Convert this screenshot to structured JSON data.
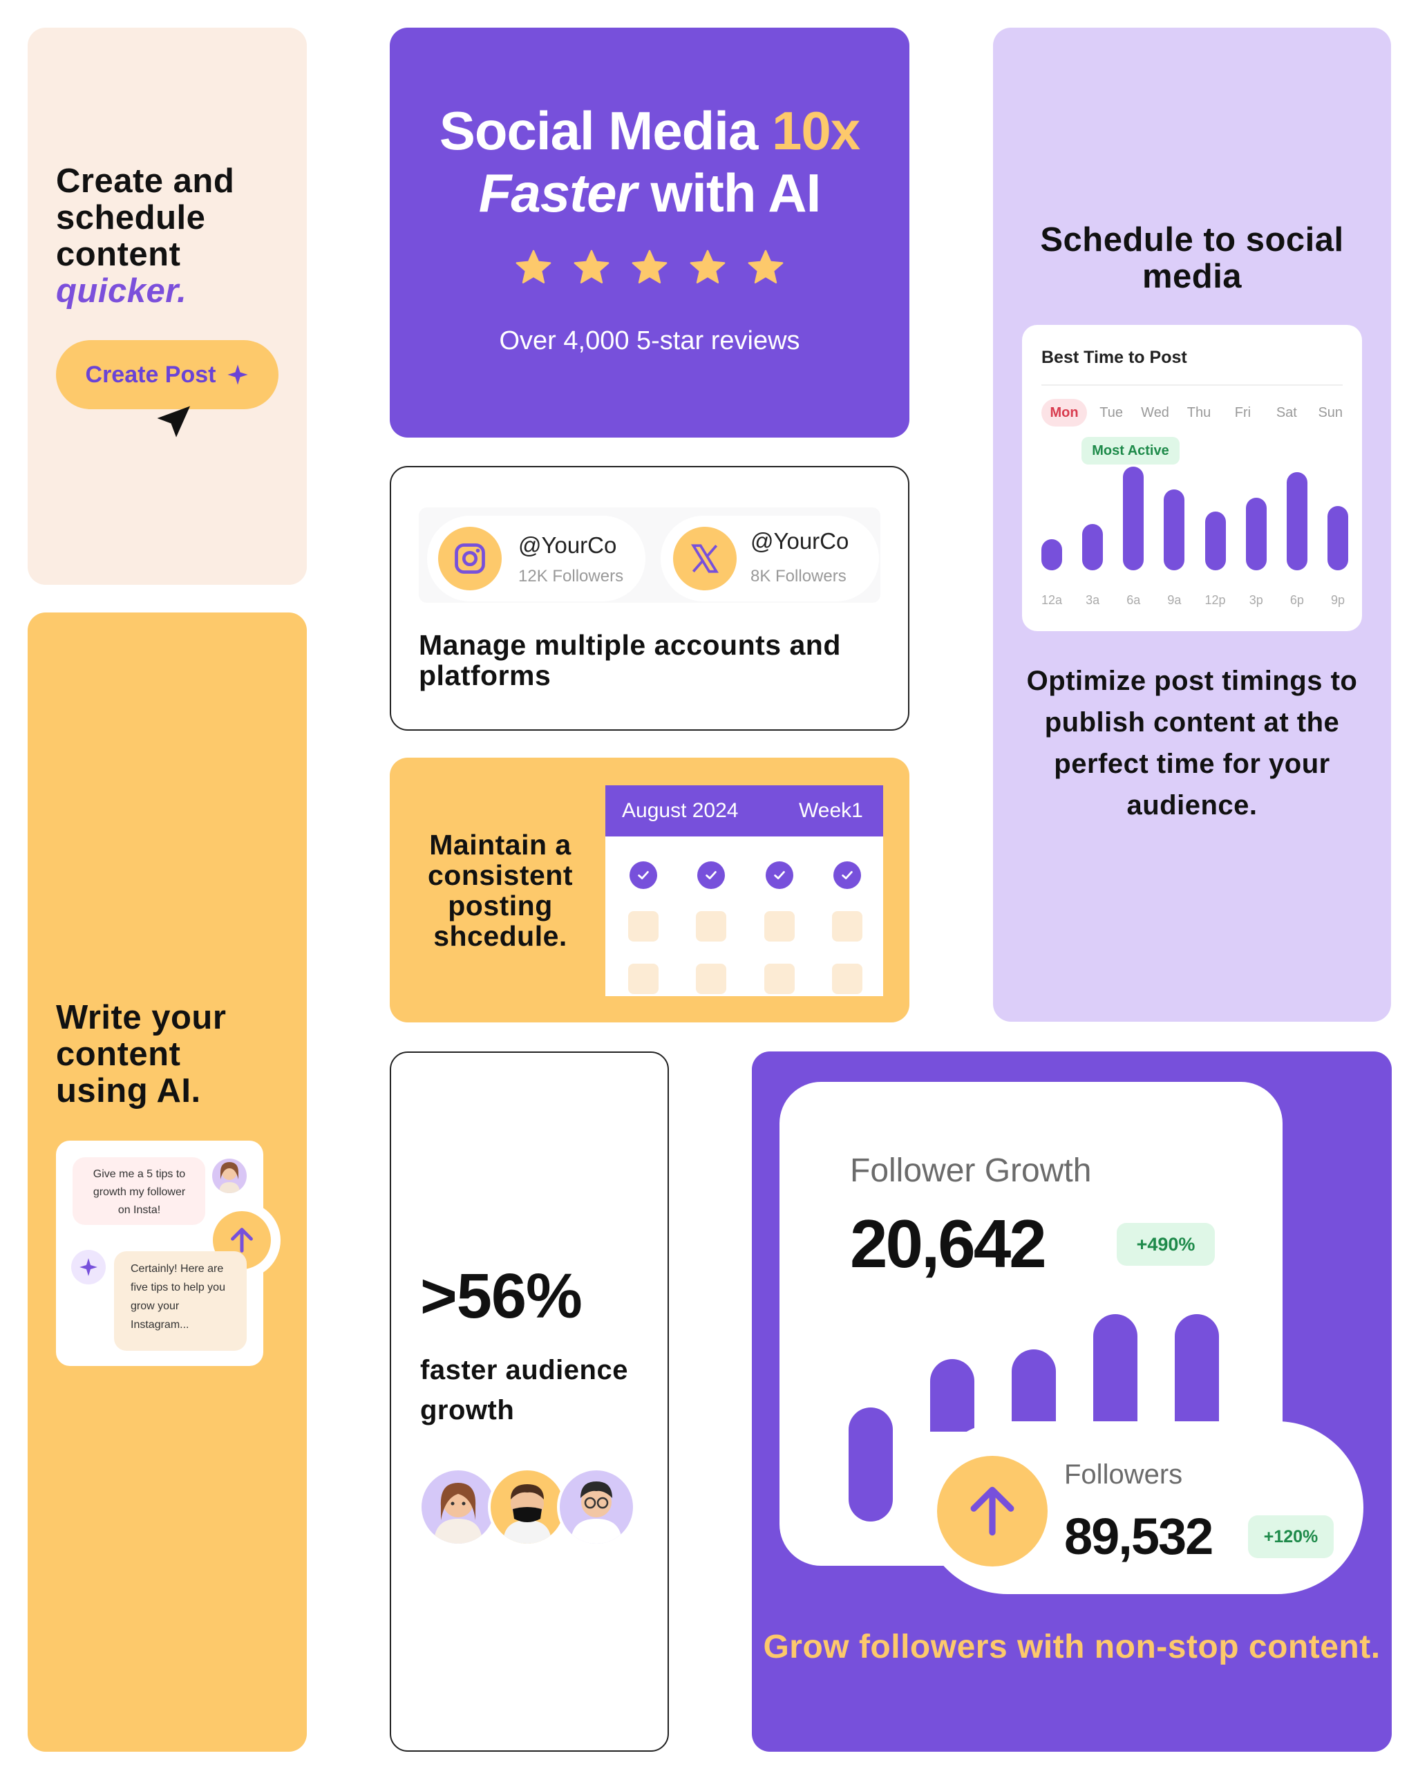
{
  "create_card": {
    "heading_line1": "Create and",
    "heading_line2": "schedule",
    "heading_line3": "content",
    "heading_emphasis": "quicker.",
    "button_label": "Create Post"
  },
  "hero_card": {
    "title_part1": "Social Media ",
    "title_highlight": "10x",
    "title_italic": "Faster",
    "title_part2": " with AI",
    "star_count": 5,
    "reviews": "Over 4,000 5-star reviews"
  },
  "schedule_card": {
    "heading": "Schedule to social media",
    "panel_title": "Best Time to Post",
    "days": [
      "Mon",
      "Tue",
      "Wed",
      "Thu",
      "Fri",
      "Sat",
      "Sun"
    ],
    "selected_day": "Mon",
    "most_active_label": "Most Active",
    "hours": [
      "12a",
      "3a",
      "6a",
      "9a",
      "12p",
      "3p",
      "6p",
      "9p"
    ],
    "activity": [
      0.3,
      0.45,
      1.0,
      0.78,
      0.57,
      0.7,
      0.95,
      0.62
    ],
    "description": "Optimize post timings to publish content at the perfect time for your audience."
  },
  "accounts_card": {
    "accounts": [
      {
        "icon": "instagram-icon",
        "handle": "@YourCo",
        "followers": "12K Followers"
      },
      {
        "icon": "x-icon",
        "handle": "@YourCo",
        "followers": "8K Followers"
      }
    ],
    "heading": "Manage multiple accounts and platforms"
  },
  "calendar_card": {
    "heading": "Maintain a consistent posting shcedule.",
    "month": "August 2024",
    "week": "Week1"
  },
  "ai_card": {
    "heading_line1": "Write your",
    "heading_line2": "content",
    "heading_line3": "using AI.",
    "user_message": "Give me a 5 tips to growth my follower on Insta!",
    "ai_reply": "Certainly! Here are five tips to help you grow your Instagram..."
  },
  "stat_card": {
    "stat": ">56%",
    "subtitle": "faster audience growth"
  },
  "growth_card": {
    "title": "Follower Growth",
    "value": "20,642",
    "value_change": "+490%",
    "bars": [
      0.58,
      0.62,
      0.7,
      1.0,
      1.0
    ],
    "followers_label": "Followers",
    "followers_value": "89,532",
    "followers_change": "+120%",
    "caption": "Grow followers with non-stop content."
  },
  "colors": {
    "purple": "#7750DB",
    "yellow": "#FDC96B",
    "peach": "#FBEDE3",
    "lavender": "#DCCEF9"
  }
}
